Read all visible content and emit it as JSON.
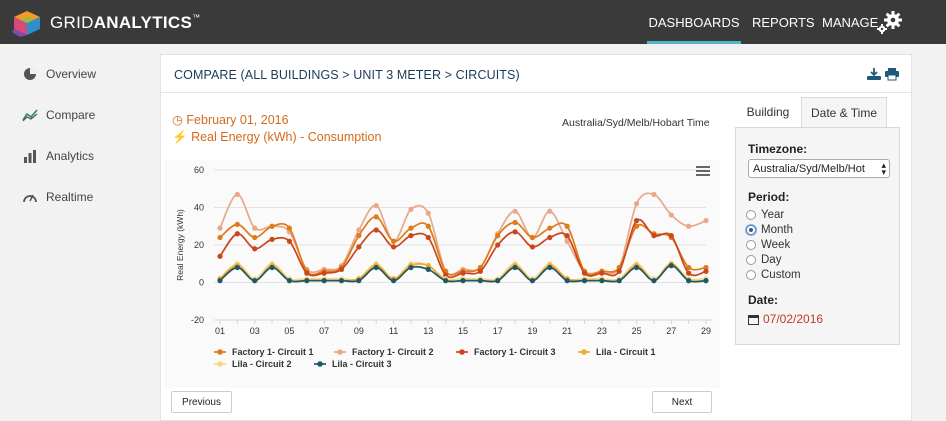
{
  "app": {
    "brand_light": "GRID",
    "brand_bold": "ANALYTICS",
    "brand_mark": "™"
  },
  "nav": {
    "dashboards": "DASHBOARDS",
    "reports": "REPORTS",
    "manage": "MANAGE",
    "active_color": "#4fb8c8"
  },
  "sidebar": {
    "items": [
      {
        "label": "Overview",
        "icon": "pie-chart-icon"
      },
      {
        "label": "Compare",
        "icon": "trend-line-icon"
      },
      {
        "label": "Analytics",
        "icon": "bar-chart-icon"
      },
      {
        "label": "Realtime",
        "icon": "gauge-icon"
      }
    ]
  },
  "panel": {
    "title": "COMPARE (ALL BUILDINGS > UNIT 3 METER > CIRCUITS)",
    "date": "February 01, 2016",
    "metric": "Real Energy (kWh) - Consumption",
    "timezone_label": "Australia/Syd/Melb/Hobart Time",
    "prev_label": "Previous",
    "next_label": "Next"
  },
  "right_panel": {
    "tabs": [
      "Building",
      "Date & Time"
    ],
    "timezone_heading": "Timezone:",
    "timezone_value": "Australia/Syd/Melb/Hot",
    "period_heading": "Period:",
    "period_options": [
      "Year",
      "Month",
      "Week",
      "Day",
      "Custom"
    ],
    "period_selected": "Month",
    "date_heading": "Date:",
    "date_value": "07/02/2016"
  },
  "chart_data": {
    "type": "line",
    "ylabel": "Real Energy (kWh)",
    "ylim": [
      -20,
      60
    ],
    "y_ticks": [
      -20,
      0,
      20,
      40,
      60
    ],
    "x": [
      1,
      2,
      3,
      4,
      5,
      6,
      7,
      8,
      9,
      10,
      11,
      12,
      13,
      14,
      15,
      16,
      17,
      18,
      19,
      20,
      21,
      22,
      23,
      24,
      25,
      26,
      27,
      28,
      29
    ],
    "x_tick_labels": [
      "01",
      "03",
      "05",
      "07",
      "09",
      "11",
      "13",
      "15",
      "17",
      "19",
      "21",
      "23",
      "25",
      "27",
      "29"
    ],
    "grid": true,
    "legend": "bottom",
    "series": [
      {
        "name": "Factory 1- Circuit 1",
        "color": "#e07b1a",
        "values": [
          24,
          31,
          24,
          30,
          29,
          6,
          6,
          8,
          25,
          35,
          22,
          29,
          30,
          6,
          6,
          8,
          25,
          32,
          24,
          29,
          30,
          6,
          6,
          8,
          30,
          26,
          24,
          8,
          8
        ]
      },
      {
        "name": "Factory 1- Circuit 2",
        "color": "#e8a889",
        "values": [
          29,
          47,
          29,
          30,
          27,
          7,
          7,
          9,
          28,
          41,
          22,
          39,
          37,
          6,
          7,
          8,
          26,
          38,
          24,
          38,
          22,
          6,
          6,
          8,
          42,
          47,
          36,
          30,
          33
        ]
      },
      {
        "name": "Factory 1- Circuit 3",
        "color": "#c9471a",
        "values": [
          14,
          26,
          18,
          23,
          22,
          5,
          5,
          7,
          19,
          28,
          19,
          25,
          24,
          4,
          5,
          6,
          20,
          27,
          19,
          24,
          25,
          5,
          5,
          6,
          33,
          25,
          25,
          5,
          6
        ]
      },
      {
        "name": "Lila - Circuit 1",
        "color": "#f0a830",
        "values": [
          2,
          9,
          1,
          9,
          1,
          1,
          1,
          1,
          2,
          9,
          2,
          9,
          9,
          1,
          1,
          1,
          1,
          9,
          1,
          9,
          2,
          1,
          1,
          1,
          9,
          1,
          10,
          1,
          1
        ]
      },
      {
        "name": "Lila - Circuit 2",
        "color": "#f5d78a",
        "values": [
          2,
          10,
          2,
          10,
          2,
          2,
          2,
          2,
          2,
          10,
          2,
          10,
          9,
          2,
          2,
          2,
          2,
          10,
          2,
          10,
          2,
          2,
          2,
          2,
          10,
          2,
          10,
          2,
          2
        ]
      },
      {
        "name": "Lila - Circuit 3",
        "color": "#1e5a66",
        "values": [
          1,
          8,
          1,
          8,
          1,
          1,
          1,
          1,
          1,
          8,
          1,
          8,
          7,
          1,
          1,
          1,
          1,
          8,
          1,
          8,
          1,
          1,
          1,
          1,
          8,
          1,
          9,
          1,
          1
        ]
      }
    ]
  }
}
